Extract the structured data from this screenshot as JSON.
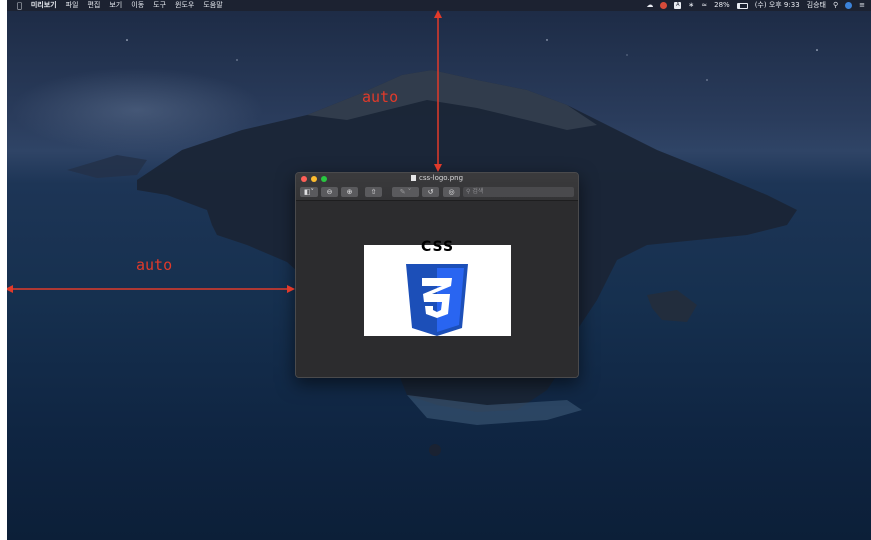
{
  "menubar": {
    "left": [
      "미리보기",
      "파일",
      "편집",
      "보기",
      "이동",
      "도구",
      "윈도우",
      "도움말"
    ],
    "right": {
      "battery_percent": "28%",
      "battery_level": 0.28,
      "datetime": "(수) 오후 9:33",
      "user": "김승태"
    },
    "icons": [
      "apple-icon",
      "cloud-icon",
      "notification-icon",
      "keyboard-a-icon",
      "bluetooth-icon",
      "wifi-icon",
      "battery-icon",
      "search-icon",
      "siri-icon",
      "list-icon"
    ]
  },
  "window": {
    "title": "css-logo.png",
    "search_placeholder": "검색",
    "image_text": "CSS",
    "image_digit": "3"
  },
  "annotations": {
    "top_label": "auto",
    "left_label": "auto"
  },
  "colors": {
    "accent_red": "#e13a2a",
    "css_blue": "#2965f1",
    "css_blue_dark": "#1c4fb8"
  }
}
